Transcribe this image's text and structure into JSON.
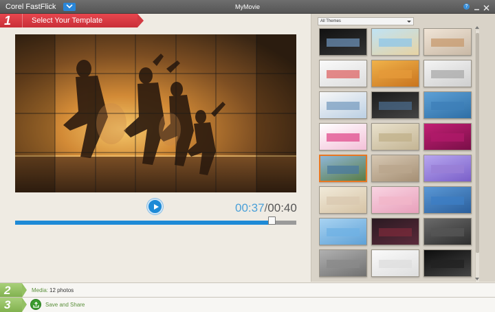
{
  "titlebar": {
    "app_name": "Corel FastFlick",
    "doc_title": "MyMovie",
    "help": "?"
  },
  "step1": {
    "number": "1",
    "label": "Select Your Template"
  },
  "player": {
    "current_time": "00:37",
    "separator": "/",
    "total_time": "00:40",
    "progress_fraction": 0.913
  },
  "themes": {
    "selected_filter": "All Themes"
  },
  "templates": [
    {
      "style": "dark",
      "accent": "#6b8fb4"
    },
    {
      "style": "beach",
      "accent": "#8ec6e8"
    },
    {
      "style": "sunset",
      "accent": "#c79a6e"
    },
    {
      "style": "white-photos",
      "accent": "#d66"
    },
    {
      "style": "orange",
      "accent": "#e59a3a"
    },
    {
      "style": "white-polaroid",
      "accent": "#aaa"
    },
    {
      "style": "white-strips",
      "accent": "#7a9ec0"
    },
    {
      "style": "dark-collage",
      "accent": "#4a6a8a"
    },
    {
      "style": "coast",
      "accent": "#3e7fb8"
    },
    {
      "style": "pink-white",
      "accent": "#e04c8c"
    },
    {
      "style": "videostudio-beige",
      "accent": "#c0b08a"
    },
    {
      "style": "magenta-frame",
      "accent": "#b01a6a"
    },
    {
      "style": "landscape-selected",
      "accent": "#4b7a9e"
    },
    {
      "style": "couple",
      "accent": "#b9a58c"
    },
    {
      "style": "purple-lights",
      "accent": "#9a7fd6"
    },
    {
      "style": "family-soft",
      "accent": "#d9c8b0"
    },
    {
      "style": "pink-floral",
      "accent": "#f2b6c8"
    },
    {
      "style": "blue-tiles",
      "accent": "#3c7dc4"
    },
    {
      "style": "sky-frames",
      "accent": "#6fb2e4"
    },
    {
      "style": "dark-strip",
      "accent": "#7a2a3a"
    },
    {
      "style": "vw-bus-dark",
      "accent": "#555"
    },
    {
      "style": "vw-bus-grey",
      "accent": "#8a8a8a"
    },
    {
      "style": "white-frame",
      "accent": "#ddd"
    },
    {
      "style": "black-car",
      "accent": "#222"
    }
  ],
  "step2": {
    "number": "2",
    "label": "Media:",
    "value": "12 photos"
  },
  "step3": {
    "number": "3",
    "label": "Save and Share"
  },
  "colors": {
    "accent_blue": "#1e8ad6",
    "step1_red": "#d23a42",
    "step_green": "#8cbc5c",
    "selected_orange": "#e87722"
  }
}
